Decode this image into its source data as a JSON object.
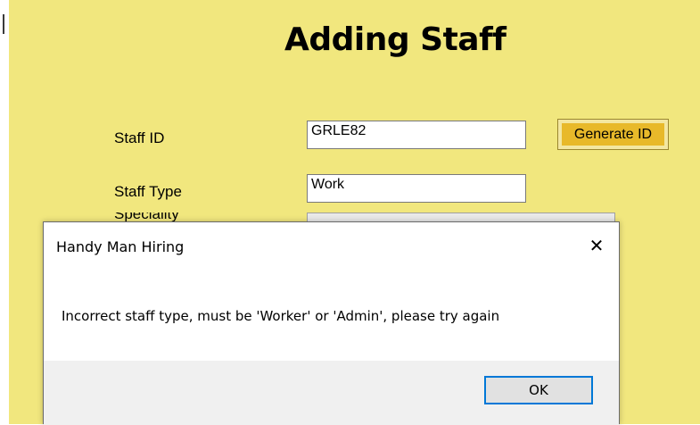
{
  "form": {
    "title": "Adding Staff",
    "staff_id": {
      "label": "Staff ID",
      "value": "GRLE82"
    },
    "generate_button_label": "Generate ID",
    "staff_type": {
      "label": "Staff Type",
      "value": "Work"
    },
    "partial_label": "Speciality"
  },
  "dialog": {
    "title": "Handy Man Hiring",
    "close_icon": "close-icon",
    "message": "Incorrect staff type, must be 'Worker' or 'Admin', please try again",
    "ok_label": "OK"
  },
  "colors": {
    "form_background": "#f1e77e",
    "generate_button": "#e8b92a",
    "ok_focus_border": "#0078d7"
  }
}
